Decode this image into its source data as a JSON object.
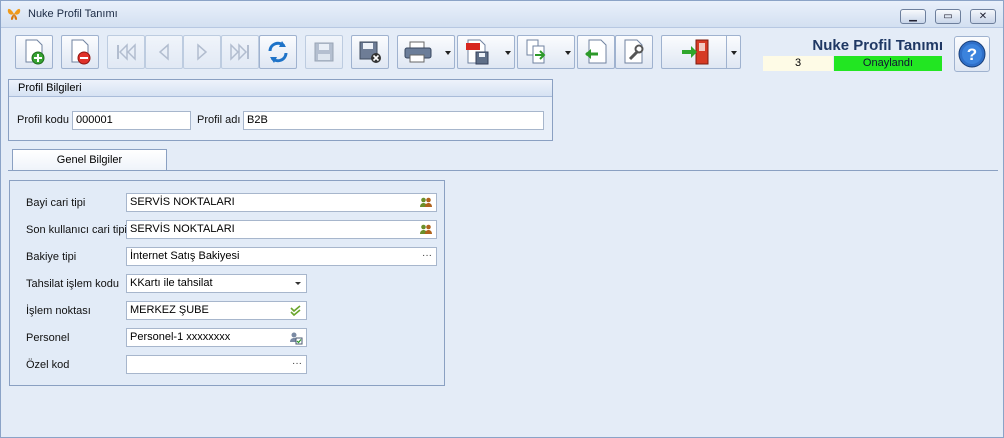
{
  "window": {
    "title": "Nuke Profil Tanımı",
    "buttons": {
      "minimize": "▁",
      "maximize": "▭",
      "close": "✕"
    }
  },
  "toolbar": {
    "items": [
      {
        "name": "new",
        "icon": "document-add-icon"
      },
      {
        "name": "delete",
        "icon": "document-delete-icon"
      },
      {
        "name": "first",
        "icon": "first-record-icon",
        "disabled": true
      },
      {
        "name": "previous",
        "icon": "previous-record-icon",
        "disabled": true
      },
      {
        "name": "next",
        "icon": "next-record-icon",
        "disabled": true
      },
      {
        "name": "last",
        "icon": "last-record-icon",
        "disabled": true
      },
      {
        "name": "refresh",
        "icon": "refresh-icon"
      },
      {
        "name": "save",
        "icon": "save-icon",
        "disabled": true
      },
      {
        "name": "cancel",
        "icon": "save-cancel-icon"
      },
      {
        "name": "print",
        "icon": "printer-icon"
      },
      {
        "name": "pdf",
        "icon": "pdf-save-icon"
      },
      {
        "name": "copy",
        "icon": "copy-document-icon"
      },
      {
        "name": "import",
        "icon": "import-icon"
      },
      {
        "name": "settings",
        "icon": "tools-icon"
      },
      {
        "name": "exit",
        "icon": "exit-door-icon"
      }
    ]
  },
  "header": {
    "form_title": "Nuke Profil Tanımı",
    "status_number": "3",
    "status_text": "Onaylandı",
    "status_color": "#22e622"
  },
  "profile": {
    "group_title": "Profil Bilgileri",
    "code_label": "Profil kodu",
    "code_value": "000001",
    "name_label": "Profil adı",
    "name_value": "B2B"
  },
  "tabs": [
    {
      "label": "Genel Bilgiler"
    }
  ],
  "general": {
    "dealer_type_label": "Bayi cari tipi",
    "dealer_type_value": "SERVİS NOKTALARI",
    "enduser_type_label": "Son kullanıcı cari tipi",
    "enduser_type_value": "SERVİS NOKTALARI",
    "balance_type_label": "Bakiye tipi",
    "balance_type_value": "İnternet Satış Bakiyesi",
    "collection_code_label": "Tahsilat işlem kodu",
    "collection_code_value": "KKartı ile tahsilat",
    "trans_point_label": "İşlem noktası",
    "trans_point_value": "MERKEZ ŞUBE",
    "personnel_label": "Personel",
    "personnel_value": "Personel-1 xxxxxxxx",
    "special_code_label": "Özel kod",
    "special_code_value": ""
  }
}
